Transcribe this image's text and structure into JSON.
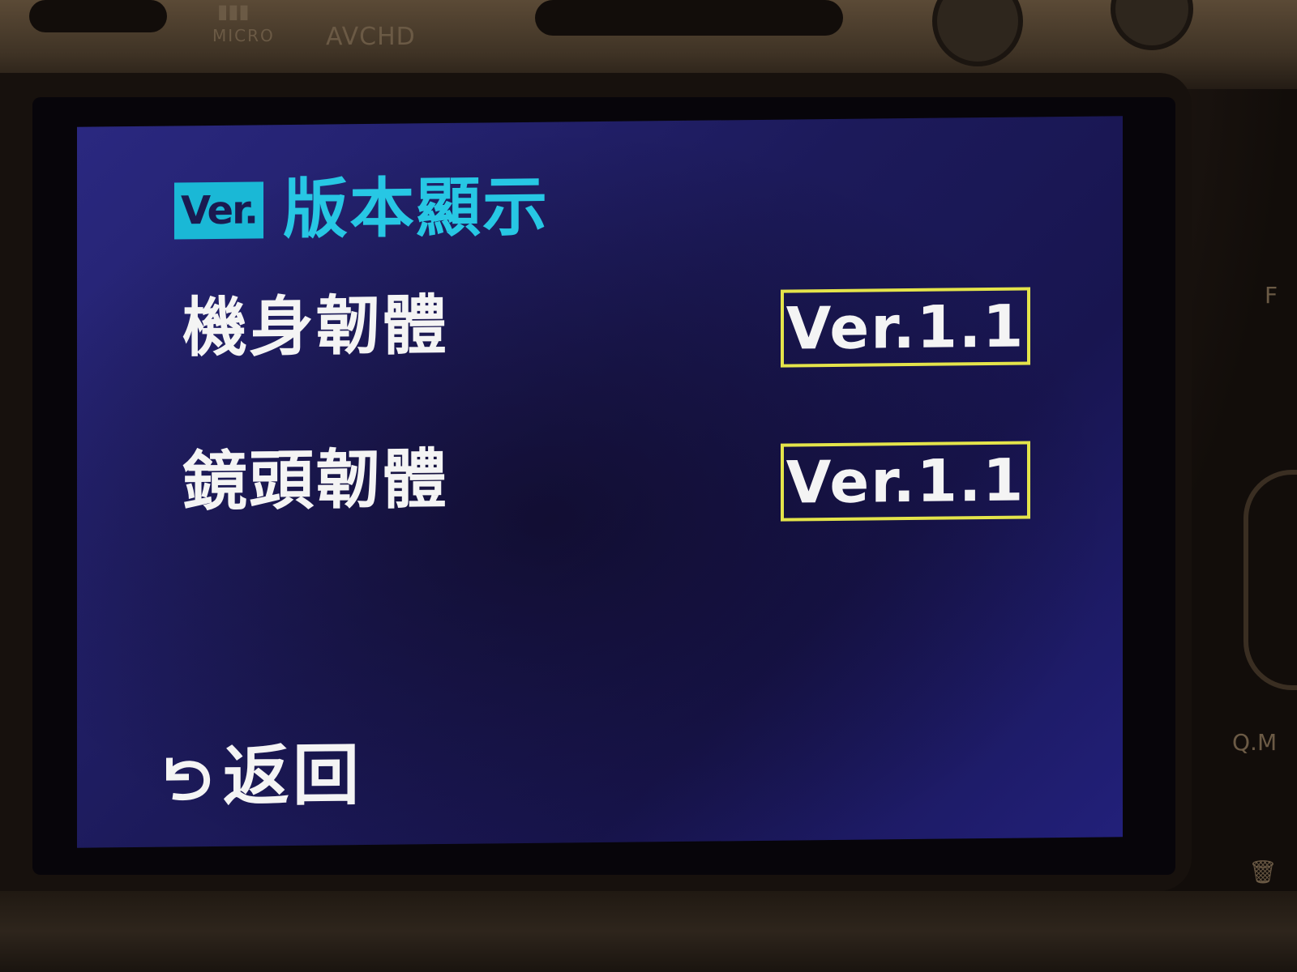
{
  "camera": {
    "brand_mark": "MICRO",
    "format_logo": "AVCHD",
    "side_labels": [
      "Q.M",
      "F"
    ]
  },
  "screen": {
    "header": {
      "badge": "Ver.",
      "title": "版本顯示"
    },
    "rows": [
      {
        "label": "機身韌體",
        "value": "Ver.1.1"
      },
      {
        "label": "鏡頭韌體",
        "value": "Ver.1.1"
      }
    ],
    "back": {
      "label": "返回",
      "icon": "return-arrow-icon"
    }
  },
  "colors": {
    "screen_bg": "#1c1a5a",
    "title": "#27c7e4",
    "badge_bg": "#1ab8d6",
    "value_border": "#e4e44a",
    "text": "#f4f4f4"
  }
}
